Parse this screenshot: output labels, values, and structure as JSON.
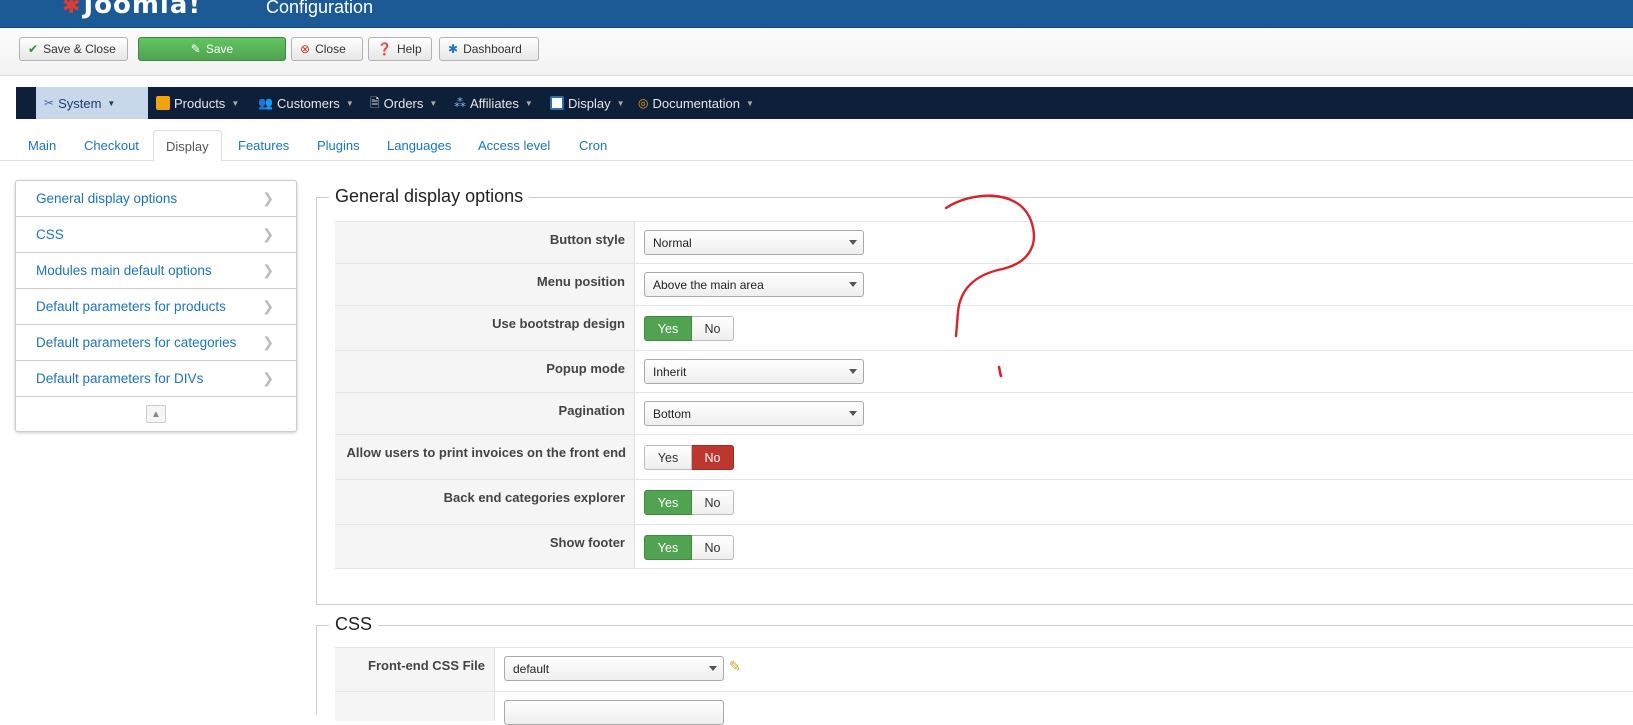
{
  "header": {
    "logo_text": "Joomla!",
    "page_title": "Configuration"
  },
  "toolbar": {
    "save_close": "Save & Close",
    "save": "Save",
    "close": "Close",
    "help": "Help",
    "dashboard": "Dashboard"
  },
  "nav": {
    "items": [
      {
        "label": "System",
        "icon": "tools-icon"
      },
      {
        "label": "Products",
        "icon": "box-icon"
      },
      {
        "label": "Customers",
        "icon": "users-icon"
      },
      {
        "label": "Orders",
        "icon": "document-icon"
      },
      {
        "label": "Affiliates",
        "icon": "affiliates-icon"
      },
      {
        "label": "Display",
        "icon": "window-icon"
      },
      {
        "label": "Documentation",
        "icon": "lifebuoy-icon"
      }
    ]
  },
  "tabs": [
    "Main",
    "Checkout",
    "Display",
    "Features",
    "Plugins",
    "Languages",
    "Access level",
    "Cron"
  ],
  "active_tab": "Display",
  "sidebar": {
    "items": [
      "General display options",
      "CSS",
      "Modules main default options",
      "Default parameters for products",
      "Default parameters for categories",
      "Default parameters for DIVs"
    ]
  },
  "general": {
    "legend": "General display options",
    "rows": {
      "button_style": {
        "label": "Button style",
        "value": "Normal"
      },
      "menu_position": {
        "label": "Menu position",
        "value": "Above the main area"
      },
      "bootstrap": {
        "label": "Use bootstrap design",
        "value": "Yes"
      },
      "popup_mode": {
        "label": "Popup mode",
        "value": "Inherit"
      },
      "pagination": {
        "label": "Pagination",
        "value": "Bottom"
      },
      "print_invoices": {
        "label": "Allow users to print invoices on the front end",
        "value": "No"
      },
      "categories_explorer": {
        "label": "Back end categories explorer",
        "value": "Yes"
      },
      "show_footer": {
        "label": "Show footer",
        "value": "Yes"
      }
    },
    "yes": "Yes",
    "no": "No"
  },
  "css": {
    "legend": "CSS",
    "frontend_label": "Front-end CSS File",
    "frontend_value": "default"
  },
  "colors": {
    "header_blue": "#1c5a96",
    "nav_dark": "#0e1f3a",
    "save_green": "#51a351",
    "link_blue": "#1a74c4",
    "no_red": "#bd362f",
    "annotation_red": "#d9232a"
  }
}
